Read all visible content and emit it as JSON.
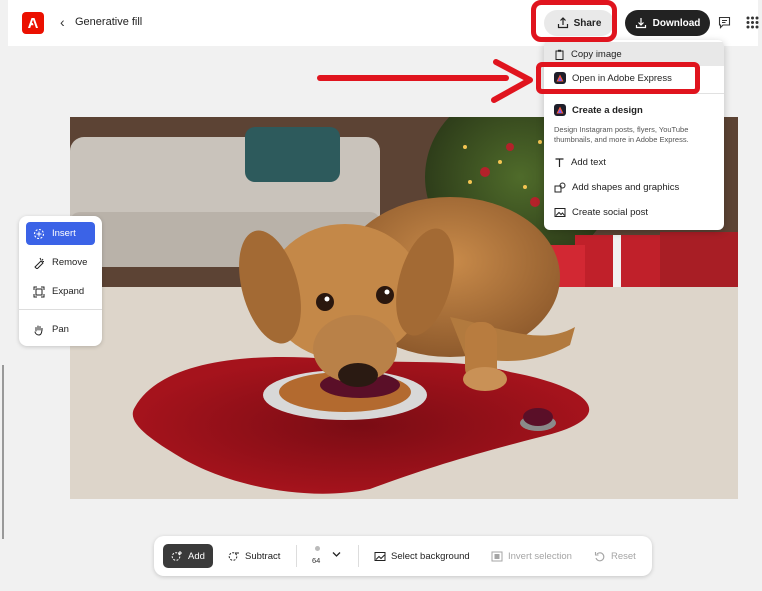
{
  "header": {
    "back_icon": "chevron-left",
    "title": "Generative fill",
    "share_label": "Share",
    "download_label": "Download"
  },
  "share_menu": {
    "items": [
      {
        "label": "Copy image",
        "icon": "clipboard-icon"
      },
      {
        "label": "Open in Adobe Express",
        "icon": "adobe-express-icon"
      }
    ],
    "section_title": "Create a design",
    "section_desc": "Design Instagram posts, flyers, YouTube thumbnails, and more in Adobe Express.",
    "actions": [
      {
        "label": "Add text",
        "icon": "text-icon"
      },
      {
        "label": "Add shapes and graphics",
        "icon": "shapes-icon"
      },
      {
        "label": "Create social post",
        "icon": "image-icon"
      }
    ]
  },
  "left_tools": [
    {
      "label": "Insert",
      "icon": "insert-icon",
      "active": true
    },
    {
      "label": "Remove",
      "icon": "remove-icon",
      "active": false
    },
    {
      "label": "Expand",
      "icon": "expand-icon",
      "active": false
    },
    {
      "label": "Pan",
      "icon": "hand-icon",
      "active": false
    }
  ],
  "bottom_tools": {
    "add_label": "Add",
    "subtract_label": "Subtract",
    "brush_size": "64",
    "select_bg_label": "Select background",
    "invert_label": "Invert selection",
    "reset_label": "Reset"
  },
  "colors": {
    "brand_red": "#eb1000",
    "annotation_red": "#e0141e",
    "active_blue": "#3b63e7",
    "dark_button": "#222222"
  }
}
